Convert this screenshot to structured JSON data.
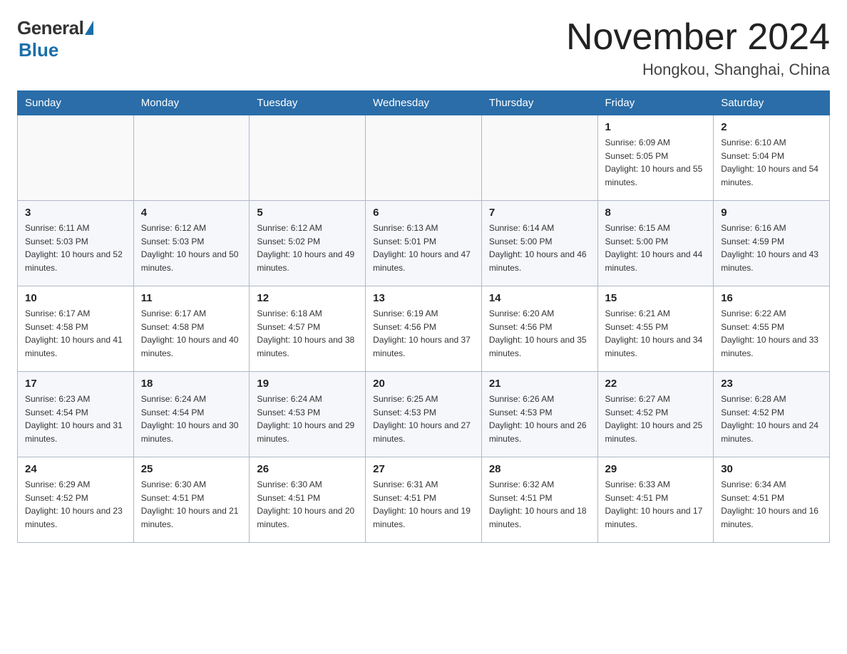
{
  "header": {
    "logo_general": "General",
    "logo_blue": "Blue",
    "month_title": "November 2024",
    "location": "Hongkou, Shanghai, China"
  },
  "weekdays": [
    "Sunday",
    "Monday",
    "Tuesday",
    "Wednesday",
    "Thursday",
    "Friday",
    "Saturday"
  ],
  "weeks": [
    [
      {
        "day": "",
        "sunrise": "",
        "sunset": "",
        "daylight": "",
        "empty": true
      },
      {
        "day": "",
        "sunrise": "",
        "sunset": "",
        "daylight": "",
        "empty": true
      },
      {
        "day": "",
        "sunrise": "",
        "sunset": "",
        "daylight": "",
        "empty": true
      },
      {
        "day": "",
        "sunrise": "",
        "sunset": "",
        "daylight": "",
        "empty": true
      },
      {
        "day": "",
        "sunrise": "",
        "sunset": "",
        "daylight": "",
        "empty": true
      },
      {
        "day": "1",
        "sunrise": "Sunrise: 6:09 AM",
        "sunset": "Sunset: 5:05 PM",
        "daylight": "Daylight: 10 hours and 55 minutes.",
        "empty": false
      },
      {
        "day": "2",
        "sunrise": "Sunrise: 6:10 AM",
        "sunset": "Sunset: 5:04 PM",
        "daylight": "Daylight: 10 hours and 54 minutes.",
        "empty": false
      }
    ],
    [
      {
        "day": "3",
        "sunrise": "Sunrise: 6:11 AM",
        "sunset": "Sunset: 5:03 PM",
        "daylight": "Daylight: 10 hours and 52 minutes.",
        "empty": false
      },
      {
        "day": "4",
        "sunrise": "Sunrise: 6:12 AM",
        "sunset": "Sunset: 5:03 PM",
        "daylight": "Daylight: 10 hours and 50 minutes.",
        "empty": false
      },
      {
        "day": "5",
        "sunrise": "Sunrise: 6:12 AM",
        "sunset": "Sunset: 5:02 PM",
        "daylight": "Daylight: 10 hours and 49 minutes.",
        "empty": false
      },
      {
        "day": "6",
        "sunrise": "Sunrise: 6:13 AM",
        "sunset": "Sunset: 5:01 PM",
        "daylight": "Daylight: 10 hours and 47 minutes.",
        "empty": false
      },
      {
        "day": "7",
        "sunrise": "Sunrise: 6:14 AM",
        "sunset": "Sunset: 5:00 PM",
        "daylight": "Daylight: 10 hours and 46 minutes.",
        "empty": false
      },
      {
        "day": "8",
        "sunrise": "Sunrise: 6:15 AM",
        "sunset": "Sunset: 5:00 PM",
        "daylight": "Daylight: 10 hours and 44 minutes.",
        "empty": false
      },
      {
        "day": "9",
        "sunrise": "Sunrise: 6:16 AM",
        "sunset": "Sunset: 4:59 PM",
        "daylight": "Daylight: 10 hours and 43 minutes.",
        "empty": false
      }
    ],
    [
      {
        "day": "10",
        "sunrise": "Sunrise: 6:17 AM",
        "sunset": "Sunset: 4:58 PM",
        "daylight": "Daylight: 10 hours and 41 minutes.",
        "empty": false
      },
      {
        "day": "11",
        "sunrise": "Sunrise: 6:17 AM",
        "sunset": "Sunset: 4:58 PM",
        "daylight": "Daylight: 10 hours and 40 minutes.",
        "empty": false
      },
      {
        "day": "12",
        "sunrise": "Sunrise: 6:18 AM",
        "sunset": "Sunset: 4:57 PM",
        "daylight": "Daylight: 10 hours and 38 minutes.",
        "empty": false
      },
      {
        "day": "13",
        "sunrise": "Sunrise: 6:19 AM",
        "sunset": "Sunset: 4:56 PM",
        "daylight": "Daylight: 10 hours and 37 minutes.",
        "empty": false
      },
      {
        "day": "14",
        "sunrise": "Sunrise: 6:20 AM",
        "sunset": "Sunset: 4:56 PM",
        "daylight": "Daylight: 10 hours and 35 minutes.",
        "empty": false
      },
      {
        "day": "15",
        "sunrise": "Sunrise: 6:21 AM",
        "sunset": "Sunset: 4:55 PM",
        "daylight": "Daylight: 10 hours and 34 minutes.",
        "empty": false
      },
      {
        "day": "16",
        "sunrise": "Sunrise: 6:22 AM",
        "sunset": "Sunset: 4:55 PM",
        "daylight": "Daylight: 10 hours and 33 minutes.",
        "empty": false
      }
    ],
    [
      {
        "day": "17",
        "sunrise": "Sunrise: 6:23 AM",
        "sunset": "Sunset: 4:54 PM",
        "daylight": "Daylight: 10 hours and 31 minutes.",
        "empty": false
      },
      {
        "day": "18",
        "sunrise": "Sunrise: 6:24 AM",
        "sunset": "Sunset: 4:54 PM",
        "daylight": "Daylight: 10 hours and 30 minutes.",
        "empty": false
      },
      {
        "day": "19",
        "sunrise": "Sunrise: 6:24 AM",
        "sunset": "Sunset: 4:53 PM",
        "daylight": "Daylight: 10 hours and 29 minutes.",
        "empty": false
      },
      {
        "day": "20",
        "sunrise": "Sunrise: 6:25 AM",
        "sunset": "Sunset: 4:53 PM",
        "daylight": "Daylight: 10 hours and 27 minutes.",
        "empty": false
      },
      {
        "day": "21",
        "sunrise": "Sunrise: 6:26 AM",
        "sunset": "Sunset: 4:53 PM",
        "daylight": "Daylight: 10 hours and 26 minutes.",
        "empty": false
      },
      {
        "day": "22",
        "sunrise": "Sunrise: 6:27 AM",
        "sunset": "Sunset: 4:52 PM",
        "daylight": "Daylight: 10 hours and 25 minutes.",
        "empty": false
      },
      {
        "day": "23",
        "sunrise": "Sunrise: 6:28 AM",
        "sunset": "Sunset: 4:52 PM",
        "daylight": "Daylight: 10 hours and 24 minutes.",
        "empty": false
      }
    ],
    [
      {
        "day": "24",
        "sunrise": "Sunrise: 6:29 AM",
        "sunset": "Sunset: 4:52 PM",
        "daylight": "Daylight: 10 hours and 23 minutes.",
        "empty": false
      },
      {
        "day": "25",
        "sunrise": "Sunrise: 6:30 AM",
        "sunset": "Sunset: 4:51 PM",
        "daylight": "Daylight: 10 hours and 21 minutes.",
        "empty": false
      },
      {
        "day": "26",
        "sunrise": "Sunrise: 6:30 AM",
        "sunset": "Sunset: 4:51 PM",
        "daylight": "Daylight: 10 hours and 20 minutes.",
        "empty": false
      },
      {
        "day": "27",
        "sunrise": "Sunrise: 6:31 AM",
        "sunset": "Sunset: 4:51 PM",
        "daylight": "Daylight: 10 hours and 19 minutes.",
        "empty": false
      },
      {
        "day": "28",
        "sunrise": "Sunrise: 6:32 AM",
        "sunset": "Sunset: 4:51 PM",
        "daylight": "Daylight: 10 hours and 18 minutes.",
        "empty": false
      },
      {
        "day": "29",
        "sunrise": "Sunrise: 6:33 AM",
        "sunset": "Sunset: 4:51 PM",
        "daylight": "Daylight: 10 hours and 17 minutes.",
        "empty": false
      },
      {
        "day": "30",
        "sunrise": "Sunrise: 6:34 AM",
        "sunset": "Sunset: 4:51 PM",
        "daylight": "Daylight: 10 hours and 16 minutes.",
        "empty": false
      }
    ]
  ]
}
